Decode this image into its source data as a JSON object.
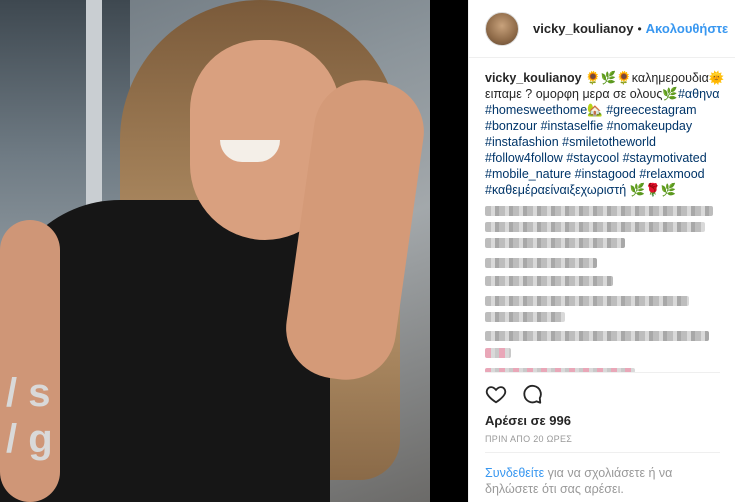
{
  "header": {
    "username": "vicky_koulianoy",
    "separator": "•",
    "follow_label": "Ακολουθήστε"
  },
  "caption": {
    "username": "vicky_koulianoy",
    "text_1": " 🌻🌿🌻καλημερουδια🌞 ειπαμε ? ομορφη μερα σε ολους🌿",
    "tags": [
      "#αθηνα",
      "#homesweethome🏡",
      "#greecestagram",
      "#bonzour",
      "#instaselfie",
      "#nomakeupday",
      "#instafashion",
      "#smiletotheworld",
      "#follow4follow",
      "#staycool",
      "#staymotivated",
      "#mobile_nature",
      "#instagood",
      "#relaxmood",
      "#καθεμέραείναιξεχωριστή"
    ],
    "tail_emoji": " 🌿🌹🌿"
  },
  "likes": {
    "text": "Αρέσει σε 996"
  },
  "timestamp": {
    "text": "ΠΡΙΝ ΑΠΟ 20 ΩΡΕΣ"
  },
  "login": {
    "link_text": "Συνδεθείτε",
    "rest_text": " για να σχολιάσετε ή να δηλώσετε ότι σας αρέσει."
  },
  "photo": {
    "print_text": "/ s\n/ g"
  },
  "icons": [
    "heart-icon",
    "comment-icon"
  ],
  "colors": {
    "accent": "#3897f0",
    "hashtag": "#003569",
    "muted": "#999999"
  }
}
